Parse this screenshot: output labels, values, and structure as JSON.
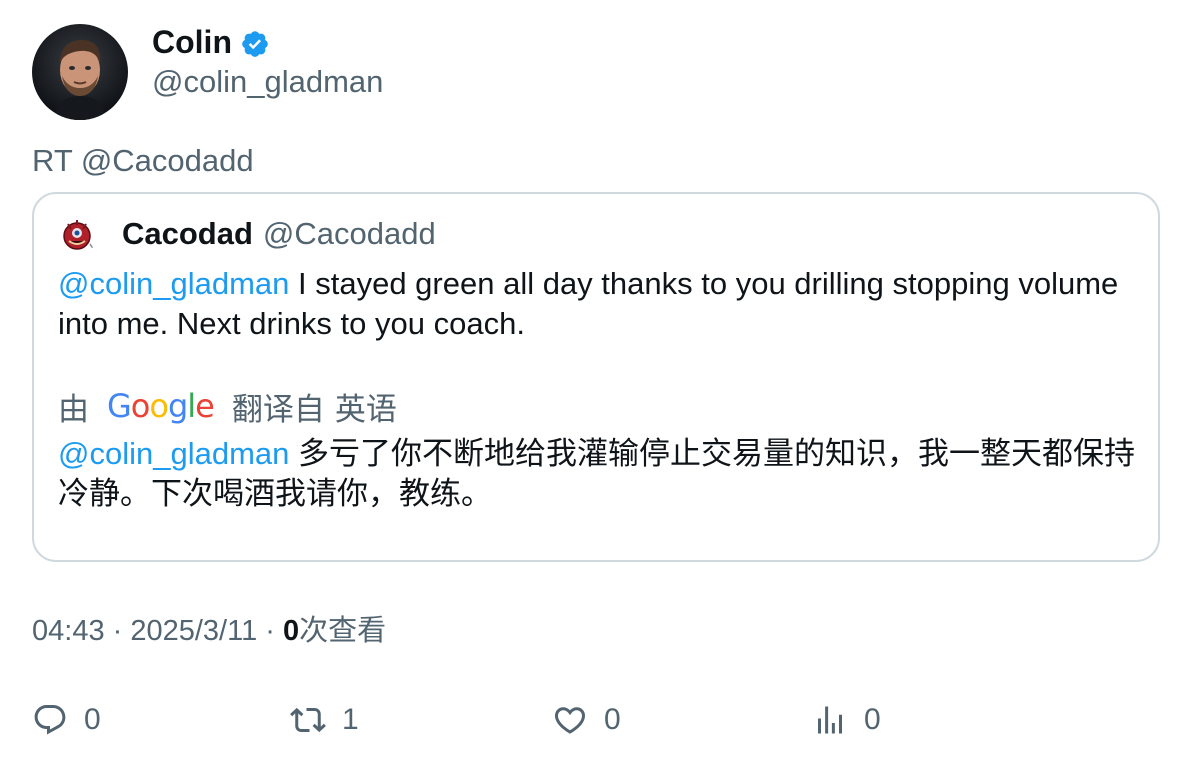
{
  "author": {
    "display_name": "Colin",
    "handle": "@colin_gladman",
    "verified": true,
    "avatar_icon": "profile-photo"
  },
  "retweet_text": "RT @Cacodadd",
  "quoted": {
    "display_name": "Cacodad",
    "handle": "@Cacodadd",
    "avatar_icon": "cacodemon-avatar",
    "mention": "@colin_gladman",
    "text": " I stayed green all day thanks to you drilling stopping volume into me. Next drinks to you coach."
  },
  "translation": {
    "prefix": "由",
    "provider_letters": [
      "G",
      "o",
      "o",
      "g",
      "l",
      "e"
    ],
    "suffix": "翻译自",
    "language": "英语",
    "mention": "@colin_gladman",
    "text": " 多亏了你不断地给我灌输停止交易量的知识，我一整天都保持冷静。下次喝酒我请你，教练。"
  },
  "meta": {
    "time": "04:43",
    "separator": " · ",
    "date": "2025/3/11",
    "views_count": "0",
    "views_label": "次查看"
  },
  "actions": {
    "reply_count": "0",
    "retweet_count": "1",
    "like_count": "0",
    "views_count": "0"
  },
  "colors": {
    "accent": "#1d9bf0",
    "text_primary": "#0f1419",
    "text_secondary": "#536471",
    "border": "#cfd9de"
  }
}
